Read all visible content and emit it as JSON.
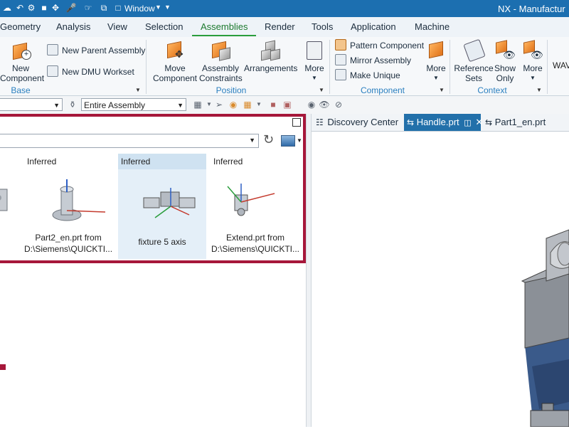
{
  "titlebar": {
    "window_menu": "Window",
    "app_title": "NX - Manufactur"
  },
  "tabs": [
    {
      "label": "Geometry"
    },
    {
      "label": "Analysis"
    },
    {
      "label": "View"
    },
    {
      "label": "Selection"
    },
    {
      "label": "Assemblies",
      "active": true
    },
    {
      "label": "Render"
    },
    {
      "label": "Tools"
    },
    {
      "label": "Application"
    },
    {
      "label": "Machine"
    }
  ],
  "ribbon": {
    "base": {
      "group_label": "Base",
      "new_component": [
        "New",
        "Component"
      ],
      "new_parent_assembly": "New Parent Assembly",
      "new_dmu_workset": "New DMU Workset"
    },
    "position": {
      "group_label": "Position",
      "move_component": [
        "Move",
        "Component"
      ],
      "assembly_constraints": [
        "Assembly",
        "Constraints"
      ],
      "arrangements": "Arrangements",
      "more": "More"
    },
    "component": {
      "group_label": "Component",
      "pattern_component": "Pattern Component",
      "mirror_assembly": "Mirror Assembly",
      "make_unique": "Make Unique",
      "more": "More"
    },
    "context": {
      "group_label": "Context",
      "reference_sets": [
        "Reference",
        "Sets"
      ],
      "show_only": [
        "Show",
        "Only"
      ],
      "more": "More"
    },
    "wave_label": "WAV"
  },
  "toolbar": {
    "scope_combo": "Entire Assembly"
  },
  "reuse_panel": {
    "cards": [
      {
        "tag": "Inferred",
        "caption": [
          "Part2_en.prt from",
          "D:\\Siemens\\QUICKTI..."
        ]
      },
      {
        "tag": "Inferred",
        "caption": [
          "fixture 5 axis"
        ],
        "selected": true
      },
      {
        "tag": "Inferred",
        "caption": [
          "Extend.prt from",
          "D:\\Siemens\\QUICKTI..."
        ]
      }
    ]
  },
  "doc_tabs": [
    {
      "label": "Discovery Center"
    },
    {
      "label": "Handle.prt",
      "active": true
    },
    {
      "label": "Part1_en.prt"
    }
  ],
  "colors": {
    "title_blue": "#1c6fb0",
    "active_tab_green": "#2a9d3c",
    "highlight_frame": "#a6173a",
    "selected_doc_tab": "#2270aa"
  }
}
